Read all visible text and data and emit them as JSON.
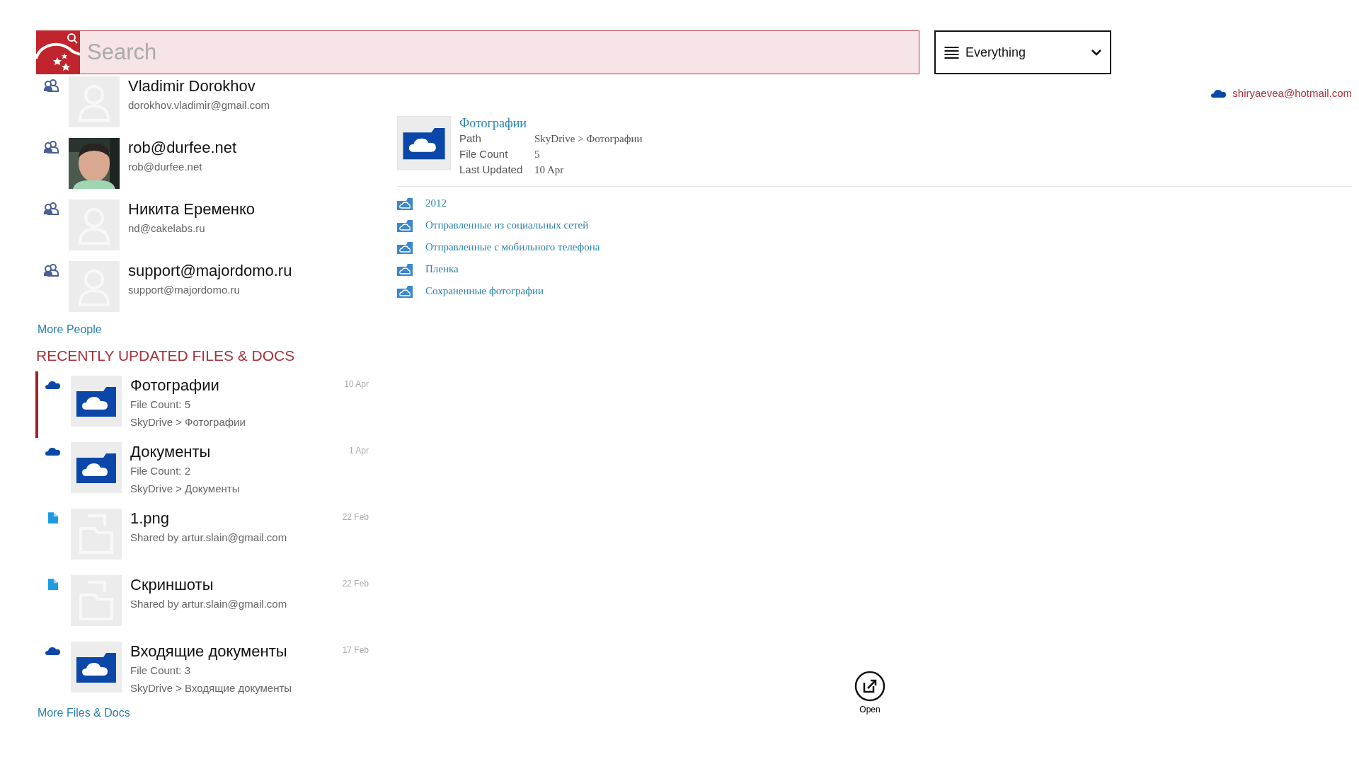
{
  "search": {
    "placeholder": "Search"
  },
  "filter": {
    "value": "Everything"
  },
  "account": {
    "email": "shiryaevea@hotmail.com"
  },
  "people": [
    {
      "name": "Vladimir Dorokhov",
      "email": "dorokhov.vladimir@gmail.com",
      "kind": "placeholder"
    },
    {
      "name": "rob@durfee.net",
      "email": "rob@durfee.net"
    },
    {
      "name": "Никита Еременко",
      "email": "nd@cakelabs.ru",
      "kind": "placeholder"
    },
    {
      "name": "support@majordomo.ru",
      "email": "support@majordomo.ru",
      "kind": "placeholder"
    }
  ],
  "more_people": "More People",
  "files_heading": "RECENTLY UPDATED FILES & DOCS",
  "files": [
    {
      "kind": "folder",
      "title": "Фотографии",
      "lines": [
        "File Count: 5",
        "SkyDrive > Фотографии"
      ],
      "date": "10 Apr",
      "selected": true
    },
    {
      "kind": "folder",
      "title": "Документы",
      "lines": [
        "File Count: 2",
        "SkyDrive > Документы"
      ],
      "date": "1 Apr",
      "selected": false
    },
    {
      "kind": "file",
      "title": "1.png",
      "lines": [
        "Shared by artur.slain@gmail.com"
      ],
      "date": "22 Feb",
      "selected": false
    },
    {
      "kind": "file",
      "title": "Скриншоты",
      "lines": [
        "Shared by artur.slain@gmail.com"
      ],
      "date": "22 Feb",
      "selected": false
    },
    {
      "kind": "folder",
      "title": "Входящие документы",
      "lines": [
        "File Count: 3",
        "SkyDrive > Входящие документы"
      ],
      "date": "17 Feb",
      "selected": false
    }
  ],
  "more_files": "More Files & Docs",
  "detail": {
    "title": "Фотографии",
    "fields": [
      {
        "label": "Path",
        "value": "SkyDrive > Фотографии"
      },
      {
        "label": "File Count",
        "value": "5"
      },
      {
        "label": "Last Updated",
        "value": "10 Apr"
      }
    ],
    "folders": [
      "2012",
      "Отправленные из социальных сетей",
      "Отправленные с мобильного телефона",
      "Пленка",
      "Сохраненные фотографии"
    ]
  },
  "app_bar": [
    {
      "label": "Open"
    }
  ]
}
